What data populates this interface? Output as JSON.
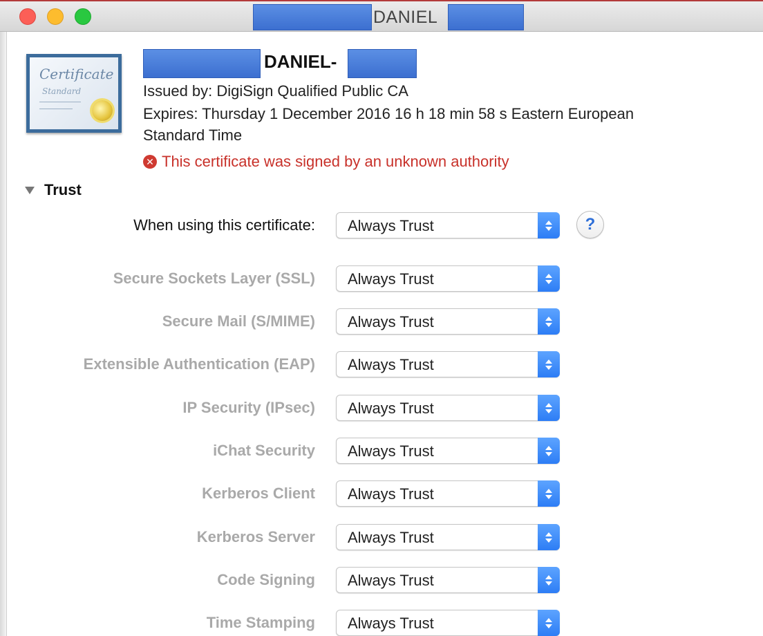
{
  "window": {
    "title": "DANIEL",
    "traffic_lights": {
      "close": "#fc5f57",
      "minimize": "#fdbc2e",
      "maximize": "#29c840"
    }
  },
  "certificate": {
    "icon": "certificate-standard-icon",
    "icon_text_top": "Certificate",
    "icon_text_bottom": "Standard",
    "name": "DANIEL-",
    "issued_by": "Issued by: DigiSign Qualified Public CA",
    "expires_line1": "Expires: Thursday 1 December 2016 16 h 18 min 58 s Eastern European",
    "expires_line2": "Standard Time",
    "error": "This certificate was signed by an unknown authority",
    "error_icon": "error-x-icon",
    "error_color": "#c8312a"
  },
  "trust": {
    "section_label": "Trust",
    "main": {
      "label": "When using this certificate:",
      "value": "Always Trust"
    },
    "help_icon": "?",
    "rows": [
      {
        "label": "Secure Sockets Layer (SSL)",
        "value": "Always Trust"
      },
      {
        "label": "Secure Mail (S/MIME)",
        "value": "Always Trust"
      },
      {
        "label": "Extensible Authentication (EAP)",
        "value": "Always Trust"
      },
      {
        "label": "IP Security (IPsec)",
        "value": "Always Trust"
      },
      {
        "label": "iChat Security",
        "value": "Always Trust"
      },
      {
        "label": "Kerberos Client",
        "value": "Always Trust"
      },
      {
        "label": "Kerberos Server",
        "value": "Always Trust"
      },
      {
        "label": "Code Signing",
        "value": "Always Trust"
      },
      {
        "label": "Time Stamping",
        "value": "Always Trust"
      }
    ]
  },
  "colors": {
    "popup_accent": "#2d7df5",
    "redaction": "#3c6fd0"
  }
}
